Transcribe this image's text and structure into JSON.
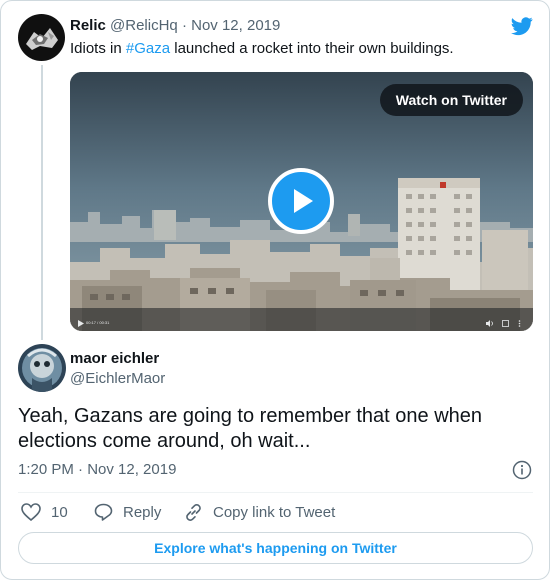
{
  "parent_tweet": {
    "name": "Relic",
    "handle": "@RelicHq",
    "separator": "·",
    "date": "Nov 12, 2019",
    "text_before": "Idiots in ",
    "hashtag": "#Gaza",
    "text_after": " launched a rocket into their own buildings.",
    "avatar_icon": "relic-avatar-icon"
  },
  "video": {
    "watch_label": "Watch on Twitter",
    "time_label": "00:17 / 00:31",
    "play_icon": "play-icon"
  },
  "tweet": {
    "name": "maor eichler",
    "handle": "@EichlerMaor",
    "text": "Yeah, Gazans are going to remember that one when elections come around, oh wait...",
    "timestamp": "1:20 PM · Nov 12, 2019"
  },
  "actions": {
    "like_count": "10",
    "reply_label": "Reply",
    "copy_link_label": "Copy link to Tweet"
  },
  "footer": {
    "explore_label": "Explore what's happening on Twitter"
  },
  "colors": {
    "accent": "#1d9bf0",
    "muted": "#536471",
    "border": "#cfd9de"
  }
}
